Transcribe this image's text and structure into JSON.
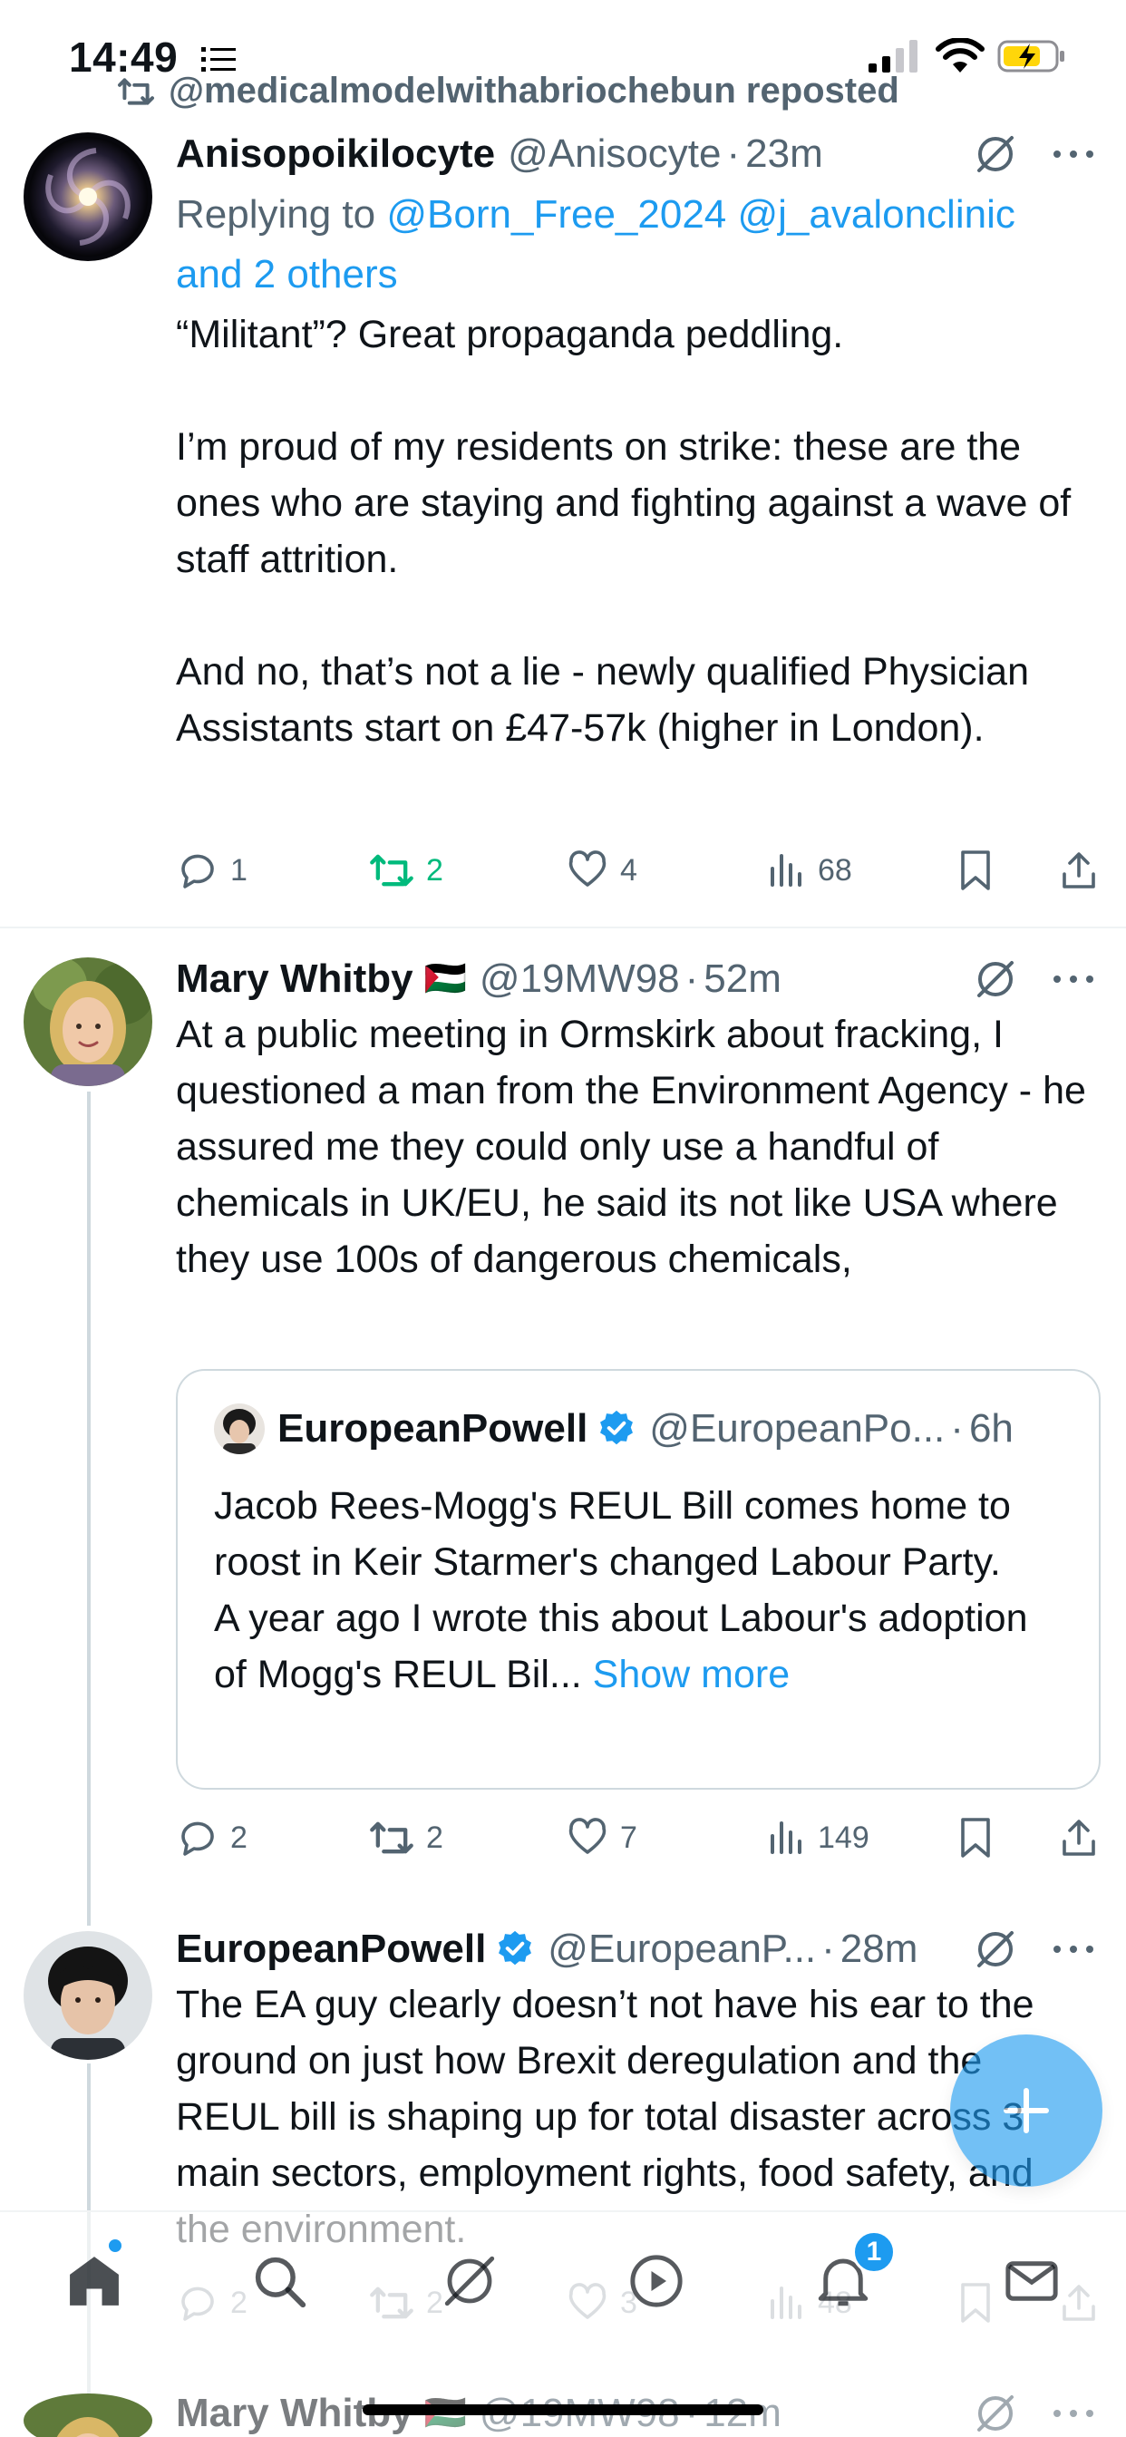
{
  "status_bar": {
    "time": "14:49"
  },
  "repost_banner": {
    "text": "@medicalmodelwithabriochebun reposted"
  },
  "tweets": [
    {
      "name": "Anisopoikilocyte",
      "handle": "@Anisocyte",
      "time": "23m",
      "reply_prefix": "Replying to ",
      "reply_mentions": "@Born_Free_2024 @j_avalonclinic",
      "reply_more": "and 2 others",
      "text": "“Militant”? Great propaganda peddling.\n\nI’m proud of my residents on strike: these are the ones who are staying and fighting against a wave of staff attrition.\n\nAnd no, that’s not a lie - newly qualified Physician Assistants start on £47-57k (higher in London).",
      "replies": "1",
      "retweets": "2",
      "likes": "4",
      "views": "68"
    },
    {
      "name": "Mary Whitby",
      "flag": "🇵🇸",
      "handle": "@19MW98",
      "time": "52m",
      "text": "At a public meeting in Ormskirk about fracking, I questioned a man from the Environment Agency - he assured me they could only use a handful of chemicals in UK/EU, he said its not like USA where they use 100s of dangerous chemicals,",
      "quote": {
        "name": "EuropeanPowell",
        "handle": "@EuropeanPo...",
        "time": "6h",
        "text": "Jacob Rees-Mogg's REUL Bill comes home to roost in Keir Starmer's changed Labour Party.\nA year ago I wrote this about Labour's adoption of Mogg's REUL Bil...",
        "show_more": "Show more"
      },
      "replies": "2",
      "retweets": "2",
      "likes": "7",
      "views": "149"
    },
    {
      "name": "EuropeanPowell",
      "handle": "@EuropeanP...",
      "time": "28m",
      "text": "The EA guy clearly doesn’t not have his ear to the ground on just how Brexit deregulation and the REUL bill is shaping up for total disaster across 3 main sectors, employment rights, food safety, and the environment.",
      "replies": "2",
      "retweets": "2",
      "likes": "3",
      "views": "48"
    },
    {
      "name": "Mary Whitby",
      "flag": "🇵🇸",
      "handle": "@19MW98",
      "time": "12m"
    }
  ],
  "bottom_nav": {
    "notifications_badge": "1"
  },
  "colors": {
    "accent": "#1d9bf0",
    "retweet_active": "#00ba7c",
    "secondary_text": "#536471"
  }
}
